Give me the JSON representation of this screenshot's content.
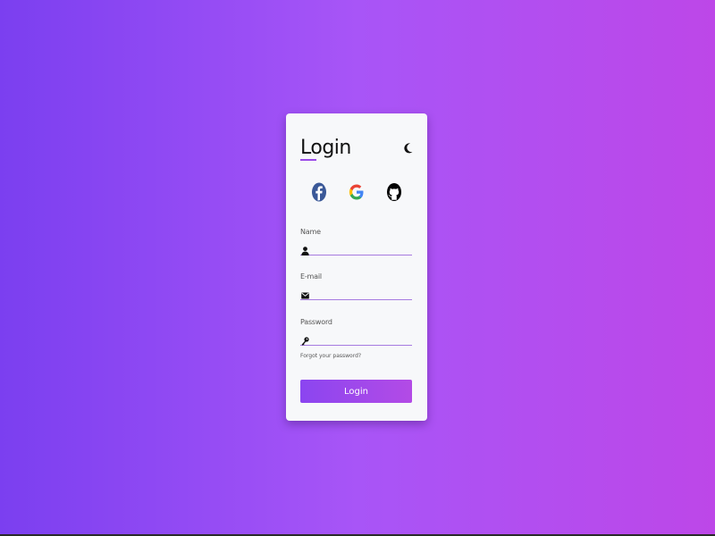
{
  "login_card": {
    "title": "Login",
    "theme_toggle_icon": "moon-icon",
    "social_logins": [
      {
        "name": "facebook",
        "icon": "facebook-icon",
        "color": "#3b5998"
      },
      {
        "name": "google",
        "icon": "google-icon",
        "color": "#4285f4"
      },
      {
        "name": "github",
        "icon": "github-icon",
        "color": "#000000"
      }
    ],
    "fields": {
      "name": {
        "label": "Name",
        "value": "",
        "icon": "user-icon"
      },
      "email": {
        "label": "E-mail",
        "value": "",
        "icon": "envelope-icon"
      },
      "password": {
        "label": "Password",
        "value": "",
        "icon": "key-icon"
      }
    },
    "forgot_password": "Forgot your password?",
    "submit_label": "Login"
  },
  "colors": {
    "background_start": "#7b3ff0",
    "background_end": "#bd47e8",
    "card_background": "#f7f8fa",
    "accent": "#9b4ce8"
  }
}
